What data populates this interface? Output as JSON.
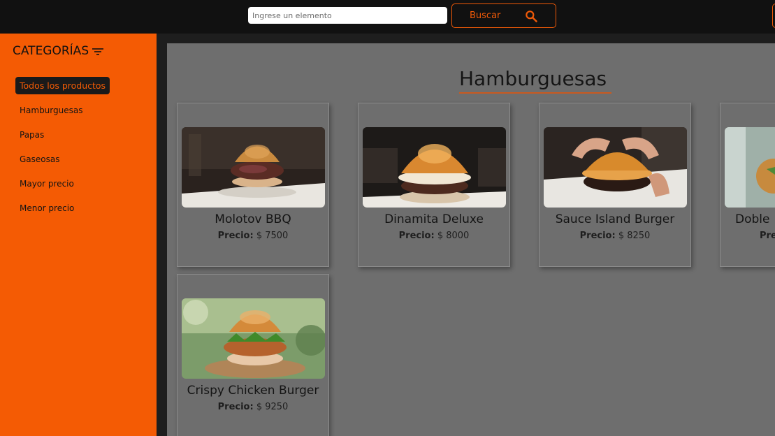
{
  "search": {
    "placeholder": "Ingrese un elemento",
    "button_label": "Buscar"
  },
  "sidebar": {
    "title": "CATEGORÍAS",
    "items": [
      {
        "label": "Todos los productos",
        "active": true
      },
      {
        "label": "Hamburguesas"
      },
      {
        "label": "Papas"
      },
      {
        "label": "Gaseosas"
      },
      {
        "label": "Mayor precio"
      },
      {
        "label": "Menor precio"
      }
    ]
  },
  "main": {
    "title": "Hamburguesas",
    "products": [
      {
        "name": "Molotov BBQ",
        "price_label": "Precio:",
        "price": "$ 7500"
      },
      {
        "name": "Dinamita Deluxe",
        "price_label": "Precio:",
        "price": "$ 8000"
      },
      {
        "name": "Sauce Island Burger",
        "price_label": "Precio:",
        "price": "$ 8250"
      },
      {
        "name": "Doble",
        "price_label": "Pre",
        "price": ""
      },
      {
        "name": "Crispy Chicken Burger",
        "price_label": "Precio:",
        "price": "$ 9250"
      }
    ]
  },
  "colors": {
    "accent": "#f45b04",
    "topbar": "#111111",
    "content_bg": "#6e6e6e"
  }
}
